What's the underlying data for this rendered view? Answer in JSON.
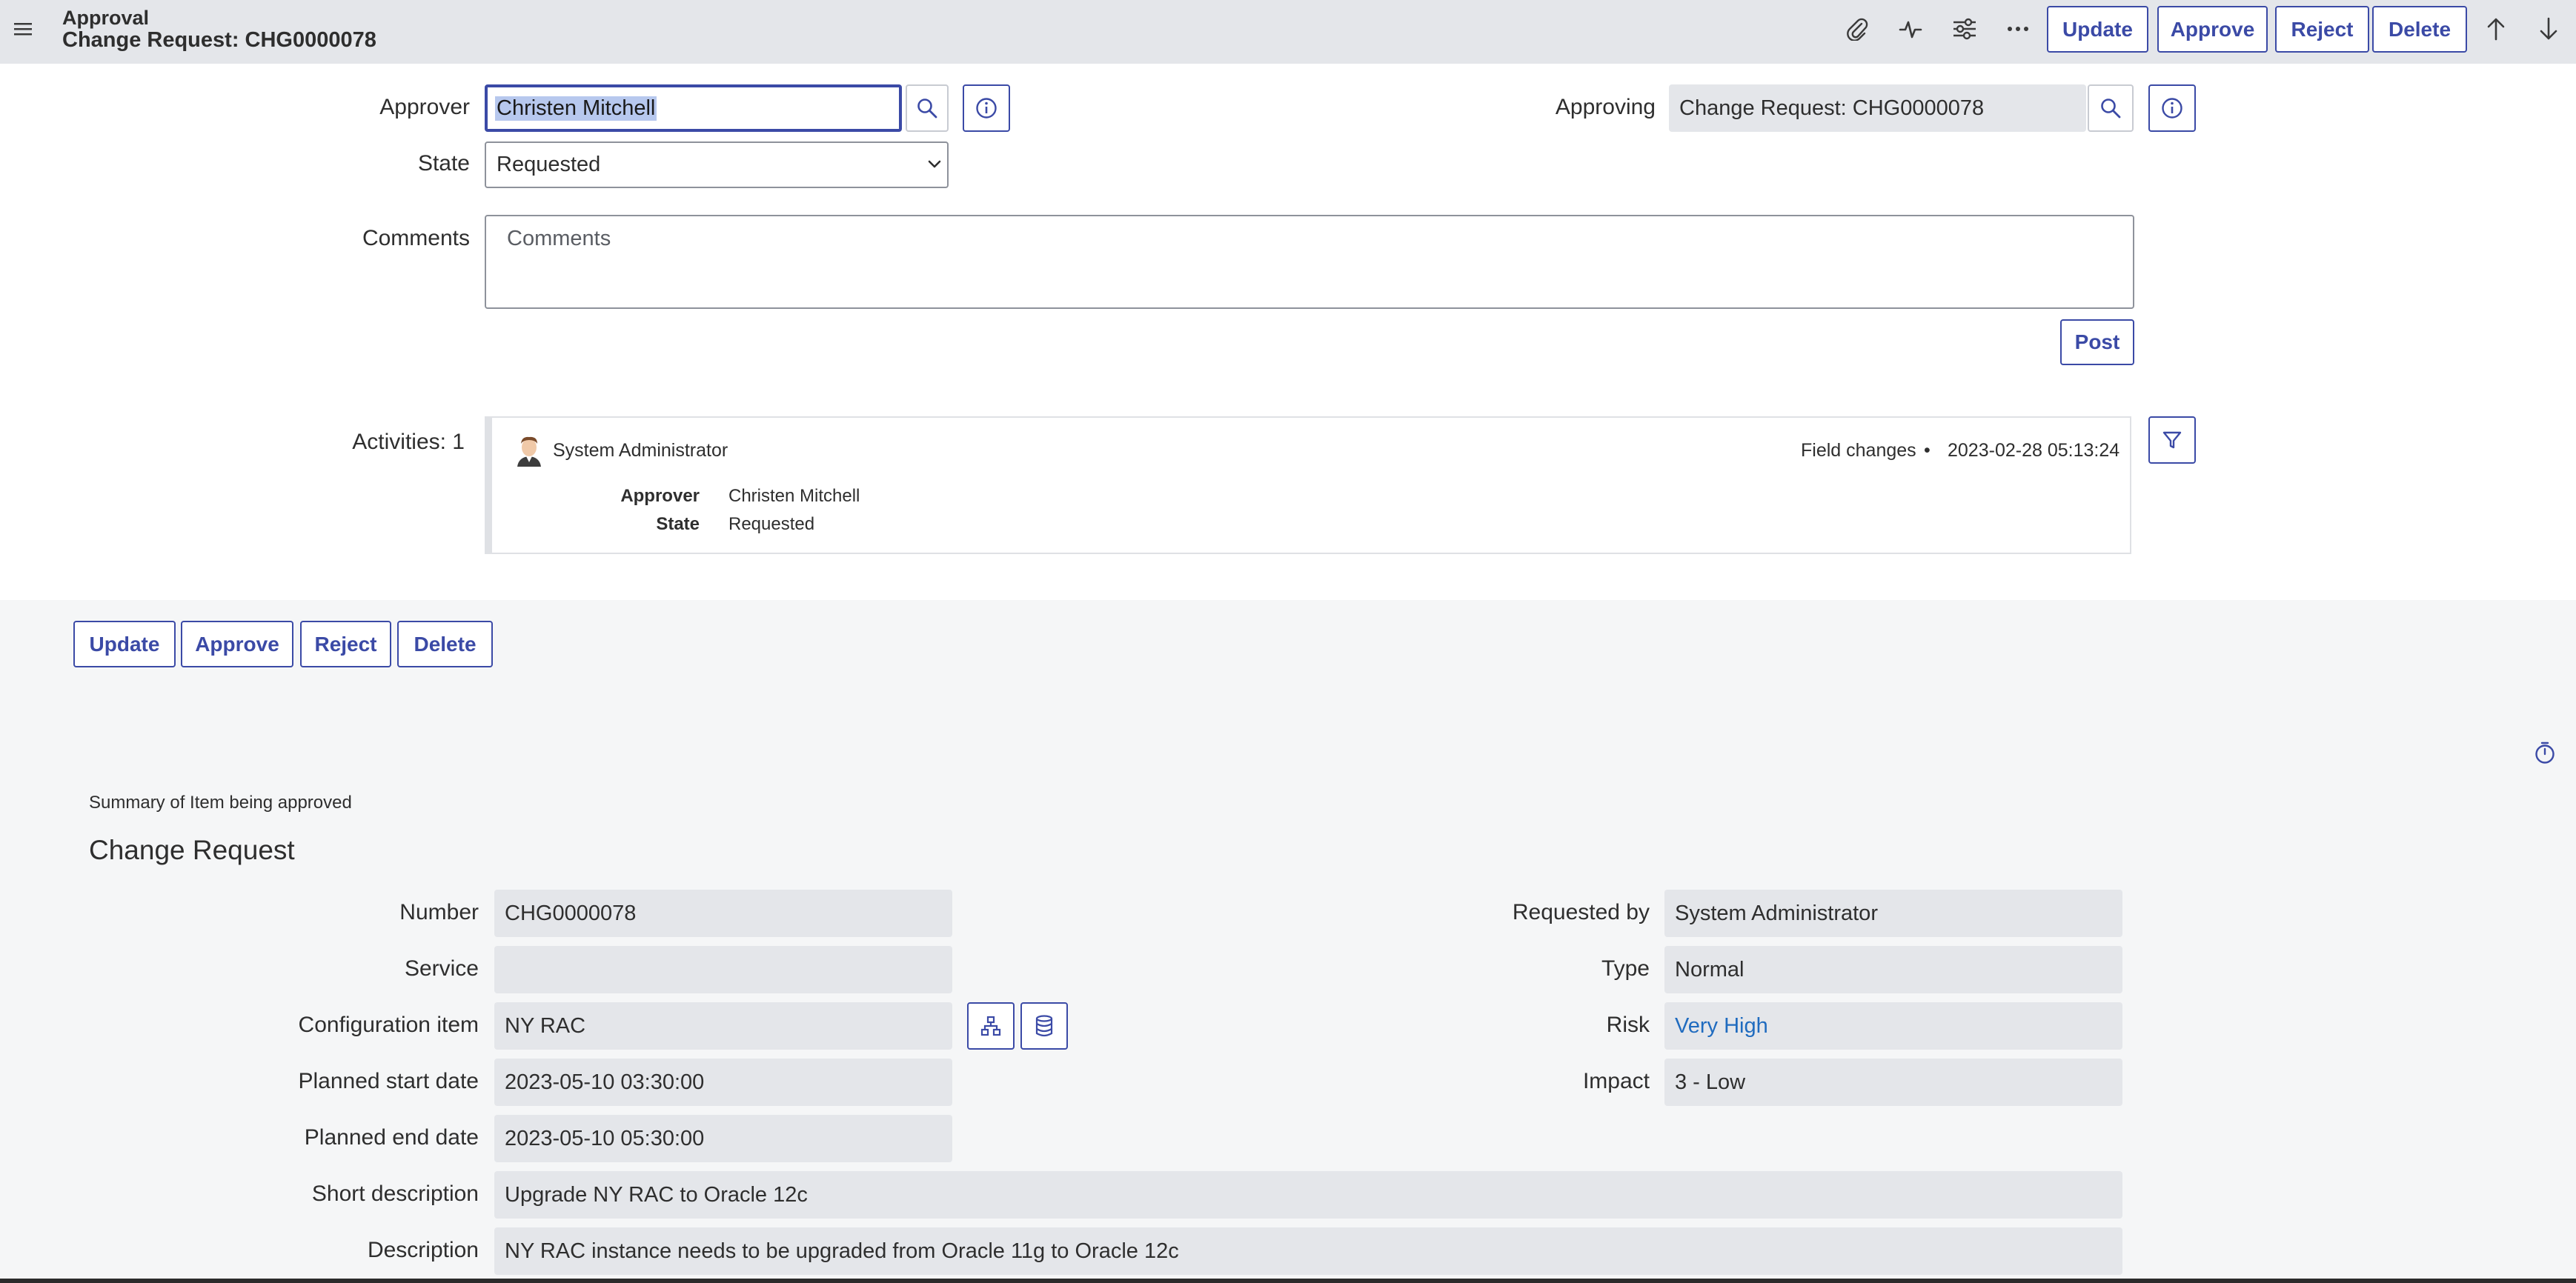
{
  "header": {
    "title": "Approval",
    "subtitle": "Change Request: CHG0000078",
    "buttons": {
      "update": "Update",
      "approve": "Approve",
      "reject": "Reject",
      "delete": "Delete"
    },
    "icons": [
      "menu-icon",
      "paperclip-icon",
      "activity-icon",
      "settings-sliders-icon",
      "more-options-icon",
      "arrow-up-icon",
      "arrow-down-icon"
    ]
  },
  "form": {
    "approver_label": "Approver",
    "approver_value": "Christen Mitchell",
    "approving_label": "Approving",
    "approving_value": "Change Request: CHG0000078",
    "state_label": "State",
    "state_value": "Requested",
    "state_options": [
      "Requested"
    ],
    "comments_label": "Comments",
    "comments_placeholder": "Comments",
    "post_label": "Post"
  },
  "activities": {
    "label": "Activities: 1",
    "entry": {
      "user": "System Administrator",
      "type": "Field changes",
      "separator": "•",
      "timestamp": "2023-02-28 05:13:24",
      "changes": [
        {
          "field": "Approver",
          "value": "Christen Mitchell"
        },
        {
          "field": "State",
          "value": "Requested"
        }
      ]
    }
  },
  "bottom_buttons": {
    "update": "Update",
    "approve": "Approve",
    "reject": "Reject",
    "delete": "Delete"
  },
  "summary": {
    "caption": "Summary of Item being approved",
    "heading": "Change Request",
    "left_fields": [
      {
        "label": "Number",
        "value": "CHG0000078"
      },
      {
        "label": "Service",
        "value": ""
      },
      {
        "label": "Configuration item",
        "value": "NY RAC"
      },
      {
        "label": "Planned start date",
        "value": "2023-05-10 03:30:00"
      },
      {
        "label": "Planned end date",
        "value": "2023-05-10 05:30:00"
      }
    ],
    "right_fields": [
      {
        "label": "Requested by",
        "value": "System Administrator"
      },
      {
        "label": "Type",
        "value": "Normal"
      },
      {
        "label": "Risk",
        "value": "Very High"
      },
      {
        "label": "Impact",
        "value": "3 - Low"
      }
    ],
    "short_description_label": "Short description",
    "short_description_value": "Upgrade NY RAC to Oracle 12c",
    "description_label": "Description",
    "description_value": "NY RAC instance needs to be upgraded from Oracle 11g to Oracle 12c"
  },
  "colors": {
    "accent": "#3b4aa6",
    "header_bg": "#e4e6ea",
    "readonly_bg": "#e4e6ea",
    "link": "#1f6bbf"
  }
}
